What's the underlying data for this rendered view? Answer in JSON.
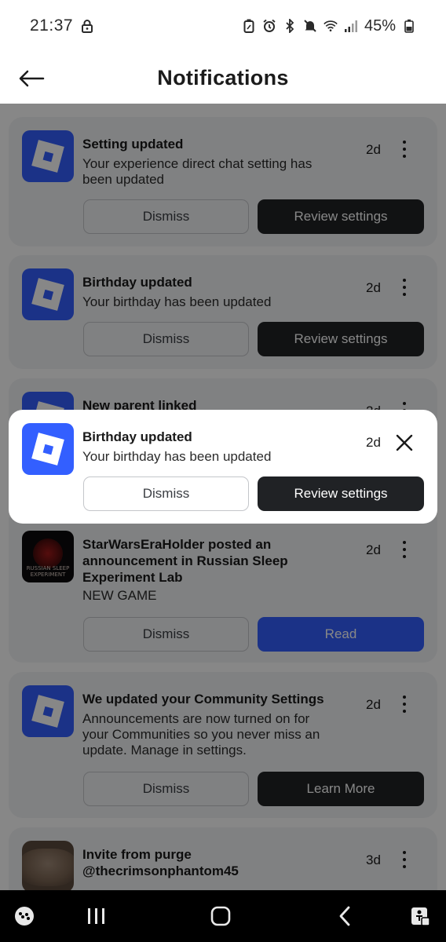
{
  "status_bar": {
    "time": "21:37",
    "battery": "45%",
    "icons": [
      "lock-icon",
      "battery-saver-icon",
      "alarm-icon",
      "bluetooth-icon",
      "mute-icon",
      "wifi-icon",
      "signal-icon",
      "battery-icon"
    ]
  },
  "header": {
    "title": "Notifications",
    "back_icon": "arrow-left-icon"
  },
  "notifications": [
    {
      "title": "Setting updated",
      "body": "Your experience direct chat setting has been updated",
      "age": "2d",
      "dismiss_label": "Dismiss",
      "action_label": "Review settings"
    },
    {
      "title": "Birthday updated",
      "body": "Your birthday has been updated",
      "age": "2d",
      "dismiss_label": "Dismiss",
      "action_label": "Review settings"
    },
    {
      "title": "New parent linked",
      "age": "2d"
    },
    {
      "title": "StarWarsEraHolder posted an announcement in Russian Sleep Experiment Lab",
      "body": "NEW GAME",
      "thumbnail_text": "RUSSIAN SLEEP EXPERIMENT",
      "age": "2d",
      "dismiss_label": "Dismiss",
      "action_label": "Read"
    },
    {
      "title": "We updated your Community Settings",
      "body": "Announcements are now turned on for your Communities so you never miss an update. Manage in settings.",
      "age": "2d",
      "dismiss_label": "Dismiss",
      "action_label": "Learn More"
    },
    {
      "title": "Invite from purge @thecrimsonphantom45",
      "age": "3d"
    }
  ],
  "focused": {
    "title": "Birthday updated",
    "body": "Your birthday has been updated",
    "age": "2d",
    "dismiss_label": "Dismiss",
    "action_label": "Review settings",
    "close_icon": "close-icon"
  },
  "colors": {
    "brand_blue": "#335fff",
    "primary_button": "#202225",
    "card_background": "#f2f3f5"
  },
  "nav_bar": {
    "icons": [
      "game-launcher-icon",
      "recent-apps-icon",
      "home-icon",
      "back-icon",
      "accessibility-icon"
    ]
  }
}
